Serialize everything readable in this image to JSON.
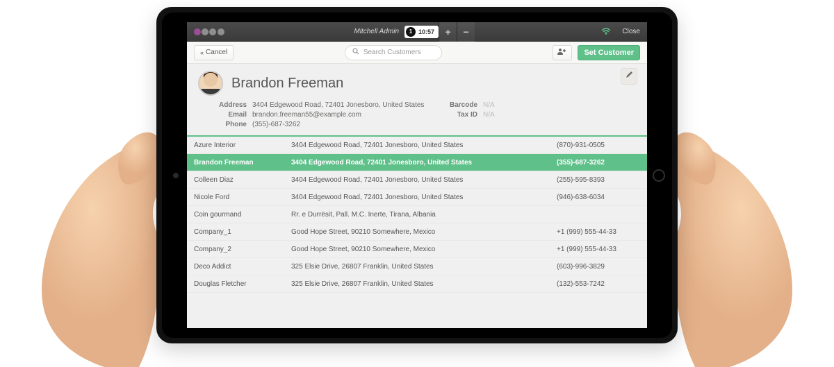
{
  "brand": {
    "name": "odoo",
    "colors": {
      "accent": "#5fc08a",
      "purple": "#9b4f96"
    }
  },
  "topbar": {
    "admin_label": "Mitchell Admin",
    "clock_count": "1",
    "clock_time": "10:57",
    "close_label": "Close"
  },
  "actions": {
    "cancel_label": "Cancel",
    "search_placeholder": "Search Customers",
    "set_customer_label": "Set Customer"
  },
  "customer": {
    "name": "Brandon Freeman",
    "fields": {
      "address_label": "Address",
      "address": "3404 Edgewood Road, 72401 Jonesboro, United States",
      "email_label": "Email",
      "email": "brandon.freeman55@example.com",
      "phone_label": "Phone",
      "phone": "(355)-687-3262",
      "barcode_label": "Barcode",
      "barcode": "N/A",
      "taxid_label": "Tax ID",
      "taxid": "N/A"
    }
  },
  "list": [
    {
      "name": "Azure Interior",
      "address": "3404 Edgewood Road, 72401 Jonesboro, United States",
      "phone": "(870)-931-0505",
      "selected": false
    },
    {
      "name": "Brandon Freeman",
      "address": "3404 Edgewood Road, 72401 Jonesboro, United States",
      "phone": "(355)-687-3262",
      "selected": true
    },
    {
      "name": "Colleen Diaz",
      "address": "3404 Edgewood Road, 72401 Jonesboro, United States",
      "phone": "(255)-595-8393",
      "selected": false
    },
    {
      "name": "Nicole Ford",
      "address": "3404 Edgewood Road, 72401 Jonesboro, United States",
      "phone": "(946)-638-6034",
      "selected": false
    },
    {
      "name": "Coin gourmand",
      "address": "Rr. e Durrësit, Pall. M.C. Inerte, Tirana, Albania",
      "phone": "",
      "selected": false
    },
    {
      "name": "Company_1",
      "address": "Good Hope Street, 90210 Somewhere, Mexico",
      "phone": "+1 (999) 555-44-33",
      "selected": false
    },
    {
      "name": "Company_2",
      "address": "Good Hope Street, 90210 Somewhere, Mexico",
      "phone": "+1 (999) 555-44-33",
      "selected": false
    },
    {
      "name": "Deco Addict",
      "address": "325 Elsie Drive, 26807 Franklin, United States",
      "phone": "(603)-996-3829",
      "selected": false
    },
    {
      "name": "Douglas Fletcher",
      "address": "325 Elsie Drive, 26807 Franklin, United States",
      "phone": "(132)-553-7242",
      "selected": false
    }
  ]
}
